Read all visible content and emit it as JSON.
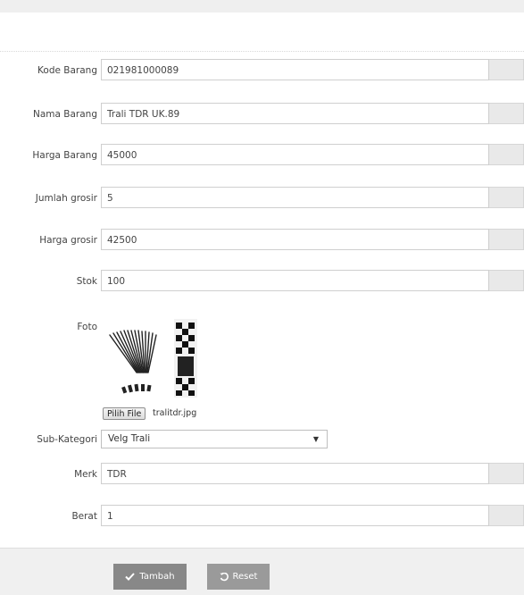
{
  "form": {
    "fields": {
      "kode_barang": {
        "label": "Kode Barang",
        "value": "021981000089"
      },
      "nama_barang": {
        "label": "Nama Barang",
        "value": "Trali TDR UK.89"
      },
      "harga_barang": {
        "label": "Harga Barang",
        "value": "45000"
      },
      "jumlah_grosir": {
        "label": "Jumlah grosir",
        "value": "5"
      },
      "harga_grosir": {
        "label": "Harga grosir",
        "value": "42500"
      },
      "stok": {
        "label": "Stok",
        "value": "100"
      },
      "merk": {
        "label": "Merk",
        "value": "TDR"
      },
      "berat": {
        "label": "Berat",
        "value": "1"
      }
    },
    "foto": {
      "label": "Foto",
      "file_button_label": "Pilih File",
      "file_name": "tralitdr.jpg"
    },
    "sub_kategori": {
      "label": "Sub-Kategori",
      "selected": "Velg Trali"
    }
  },
  "footer": {
    "submit_label": "Tambah",
    "reset_label": "Reset"
  },
  "icons": {
    "submit": "check-icon",
    "reset": "undo-icon",
    "select": "caret-down-icon"
  },
  "colors": {
    "submit_button": "#888888",
    "reset_button": "#9a9a9a",
    "footer_bg": "#f0f0f0"
  }
}
